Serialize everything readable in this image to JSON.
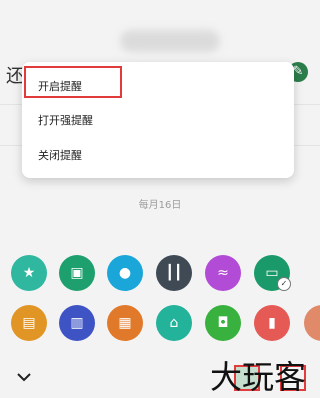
{
  "screen": {
    "title_fragment": "还",
    "monthly_label": "每月16日"
  },
  "popup": {
    "items": [
      {
        "label": "开启提醒"
      },
      {
        "label": "打开强提醒"
      },
      {
        "label": "关闭提醒"
      }
    ]
  },
  "icons_row1": [
    {
      "name": "star-icon",
      "color": "#2fb7a0"
    },
    {
      "name": "ticket-icon",
      "color": "#1e9f6e"
    },
    {
      "name": "droplet-icon",
      "color": "#1aa6d9"
    },
    {
      "name": "dumbbell-icon",
      "color": "#3f4a55"
    },
    {
      "name": "wifi-icon",
      "color": "#b24bd6"
    },
    {
      "name": "wallet-icon",
      "color": "#1a9a6a"
    }
  ],
  "icons_row2": [
    {
      "name": "briefcase-icon",
      "color": "#e19524"
    },
    {
      "name": "book-icon",
      "color": "#3f54c4"
    },
    {
      "name": "calendar-icon",
      "color": "#e07a2a"
    },
    {
      "name": "home-icon",
      "color": "#22b39a"
    },
    {
      "name": "safe-icon",
      "color": "#39b13e"
    },
    {
      "name": "lock-icon",
      "color": "#e55a55"
    }
  ],
  "watermark": "大玩客"
}
